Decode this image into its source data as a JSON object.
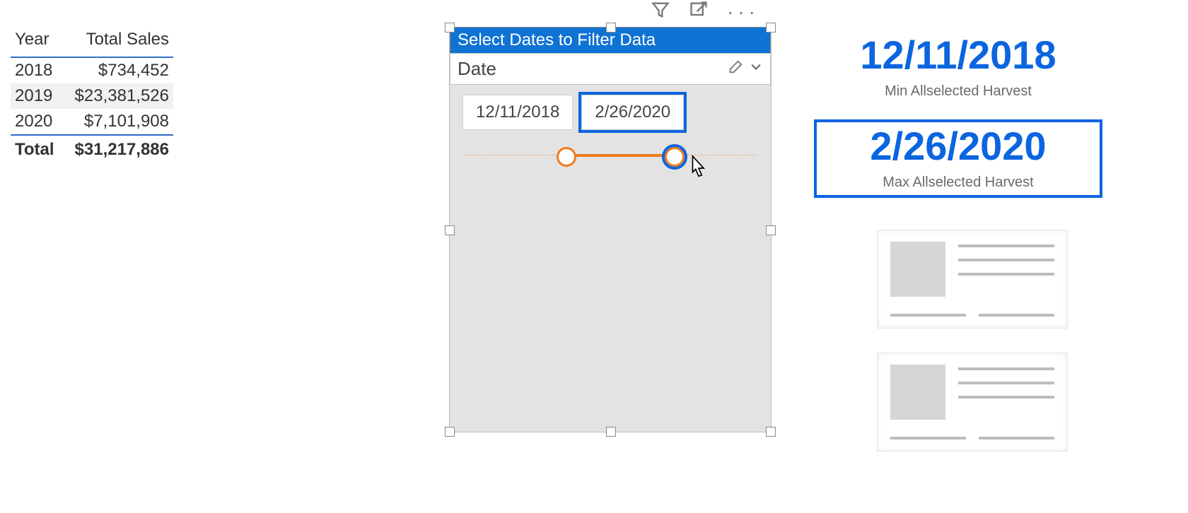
{
  "colors": {
    "accent_blue": "#0b65e0",
    "slider_orange": "#f07c1e"
  },
  "sales_table": {
    "columns": [
      "Year",
      "Total Sales"
    ],
    "rows": [
      {
        "year": "2018",
        "total": "$734,452"
      },
      {
        "year": "2019",
        "total": "$23,381,526"
      },
      {
        "year": "2020",
        "total": "$7,101,908"
      }
    ],
    "total_label": "Total",
    "total_value": "$31,217,886"
  },
  "slicer": {
    "title": "Select Dates to Filter Data",
    "field_name": "Date",
    "start_date": "12/11/2018",
    "end_date": "2/26/2020",
    "start_pct": 35,
    "end_pct": 72
  },
  "cards": {
    "min_value": "12/11/2018",
    "min_label": "Min Allselected Harvest",
    "max_value": "2/26/2020",
    "max_label": "Max Allselected Harvest"
  }
}
